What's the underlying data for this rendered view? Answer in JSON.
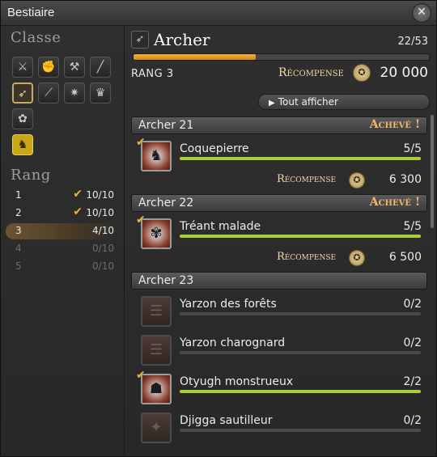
{
  "window": {
    "title": "Bestiaire",
    "close_icon": "close-icon"
  },
  "classes": {
    "heading": "Classe",
    "icons": [
      {
        "name": "sword-icon",
        "glyph": "⚔"
      },
      {
        "name": "gauntlet-icon",
        "glyph": "✊"
      },
      {
        "name": "axe-icon",
        "glyph": "⚒"
      },
      {
        "name": "lance-icon",
        "glyph": "╱"
      },
      {
        "name": "bow-icon",
        "glyph": "➶",
        "selected": true
      },
      {
        "name": "scythe-icon",
        "glyph": "⟋"
      },
      {
        "name": "staff-icon",
        "glyph": "✷"
      },
      {
        "name": "crown-icon",
        "glyph": "♛"
      },
      {
        "name": "tome-icon",
        "glyph": "✿"
      },
      {
        "name": "chocobo-icon",
        "glyph": "♞",
        "gold": true
      }
    ]
  },
  "ranks": {
    "heading": "Rang",
    "rows": [
      {
        "num": "1",
        "value": "10/10",
        "done": true,
        "state": "normal"
      },
      {
        "num": "2",
        "value": "10/10",
        "done": true,
        "state": "normal"
      },
      {
        "num": "3",
        "value": "4/10",
        "done": false,
        "state": "current"
      },
      {
        "num": "4",
        "value": "0/10",
        "done": false,
        "state": "dim"
      },
      {
        "num": "5",
        "value": "0/10",
        "done": false,
        "state": "dim"
      }
    ]
  },
  "job": {
    "name": "Archer",
    "icon": "bow-icon",
    "count": "22/53",
    "progress": 0.415,
    "rank_label": "RANG 3",
    "reward_label": "Récompense",
    "reward_value": "20 000"
  },
  "show_all_label": "Tout afficher",
  "groups": [
    {
      "name": "Archer 21",
      "status": "Achevé !",
      "mobs": [
        {
          "name": "Coquepierre",
          "count": "5/5",
          "progress": 1.0,
          "done": true,
          "icon": "boar-icon"
        }
      ],
      "reward_label": "Récompense",
      "reward_value": "6 300"
    },
    {
      "name": "Archer 22",
      "status": "Achevé !",
      "mobs": [
        {
          "name": "Tréant malade",
          "count": "5/5",
          "progress": 1.0,
          "done": true,
          "icon": "treant-icon"
        }
      ],
      "reward_label": "Récompense",
      "reward_value": "6 500"
    },
    {
      "name": "Archer 23",
      "status": "",
      "mobs": [
        {
          "name": "Yarzon des forêts",
          "count": "0/2",
          "progress": 0.0,
          "done": false,
          "icon": "yarzon-icon"
        },
        {
          "name": "Yarzon charognard",
          "count": "0/2",
          "progress": 0.0,
          "done": false,
          "icon": "yarzon-icon"
        },
        {
          "name": "Otyugh monstrueux",
          "count": "2/2",
          "progress": 1.0,
          "done": true,
          "icon": "otyugh-icon"
        },
        {
          "name": "Djigga sautilleur",
          "count": "0/2",
          "progress": 0.0,
          "done": false,
          "icon": "djigga-icon"
        }
      ]
    }
  ]
}
